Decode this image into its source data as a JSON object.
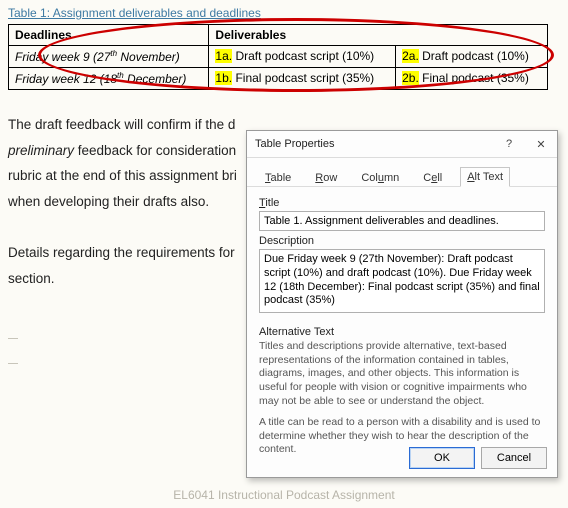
{
  "caption": "Table 1: Assignment deliverables and deadlines",
  "table": {
    "headers": [
      "Deadlines",
      "Deliverables"
    ],
    "rows": [
      {
        "deadline_pre": "Friday week 9 (27",
        "deadline_sup": "th",
        "deadline_post": " November)",
        "cell_a_tag": "1a.",
        "cell_a_rest": " Draft podcast script (10%)",
        "cell_b_tag": "2a.",
        "cell_b_rest": " Draft podcast (10%)"
      },
      {
        "deadline_pre": "Friday week 12 (18",
        "deadline_sup": "th",
        "deadline_post": " December)",
        "cell_a_tag": "1b.",
        "cell_a_rest": " Final podcast script (35%)",
        "cell_b_tag": "2b.",
        "cell_b_rest": " Final podcast (35%)"
      }
    ]
  },
  "paragraph1_a": "The draft feedback will confirm if the d",
  "paragraph1_b": "preliminary",
  "paragraph1_c": " feedback for consideration",
  "paragraph1_d": "rubric at the end of this assignment bri",
  "paragraph1_e": "when developing their drafts also.",
  "paragraph2": "Details regarding the requirements for ",
  "paragraph2b": "section.",
  "footer": "EL6041 Instructional Podcast Assignment",
  "dialog": {
    "title": "Table Properties",
    "help_icon": "?",
    "close_icon": "✕",
    "tabs": {
      "table": "Table",
      "row": "Row",
      "column": "Column",
      "cell": "Cell",
      "alt": "Alt Text",
      "u": {
        "table": "T",
        "row": "R",
        "column": "u",
        "cell": "e",
        "alt": "A"
      }
    },
    "title_lbl": "Title",
    "title_lbl_u": "T",
    "title_val": "Table 1. Assignment deliverables and deadlines.",
    "desc_lbl": "Description",
    "desc_val": "Due Friday week 9 (27th November): Draft podcast script (10%) and draft podcast (10%). Due Friday week 12 (18th December): Final podcast script (35%) and final podcast (35%)",
    "alt_h": "Alternative Text",
    "alt_p1": "Titles and descriptions provide alternative, text-based representations of the information contained in tables, diagrams, images, and other objects. This information is useful for people with vision or cognitive impairments who may not be able to see or understand the object.",
    "alt_p2": "A title can be read to a person with a disability and is used to determine whether they wish to hear the description of the content.",
    "ok": "OK",
    "cancel": "Cancel"
  }
}
